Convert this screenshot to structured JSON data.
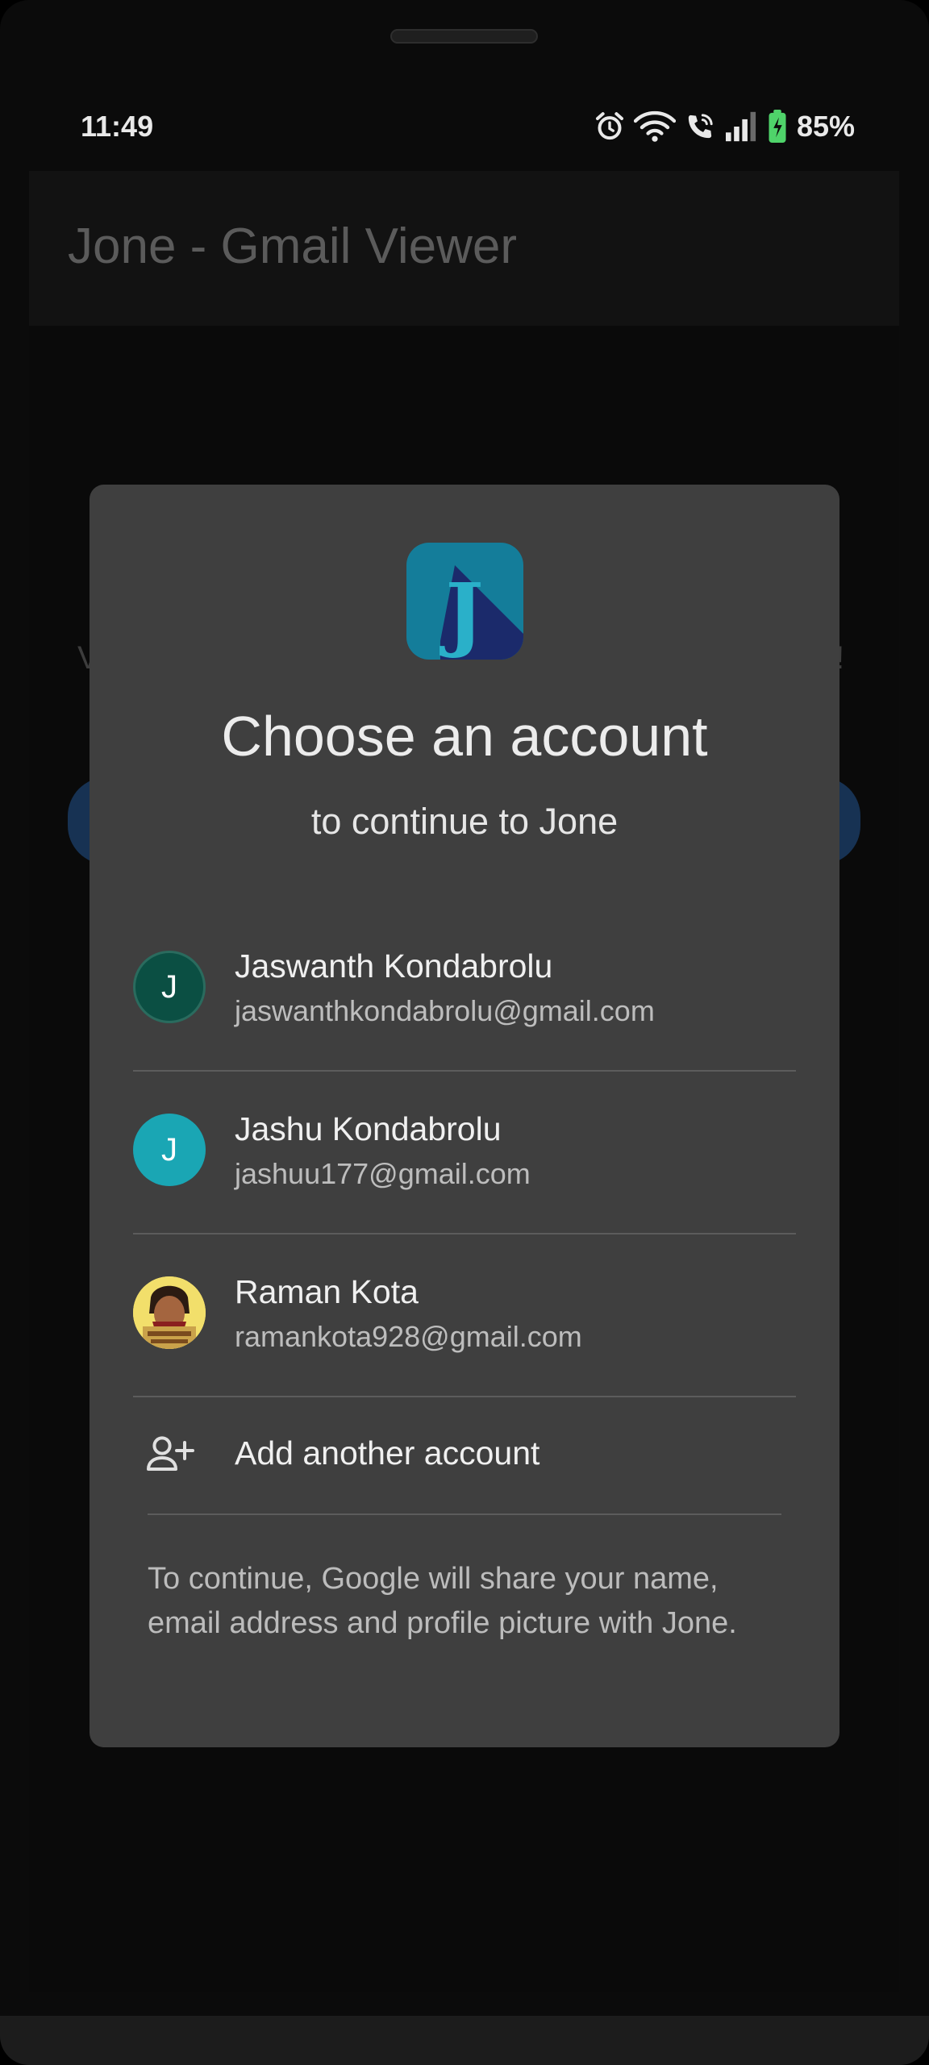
{
  "status_bar": {
    "time": "11:49",
    "battery": "85%",
    "icons": [
      "alarm-icon",
      "wifi-icon",
      "wifi-calling-icon",
      "signal-icon",
      "battery-charging-icon"
    ]
  },
  "app_bar": {
    "title": "Jone - Gmail Viewer"
  },
  "background": {
    "left_fragment": "V",
    "right_fragment": "!"
  },
  "dialog": {
    "app_icon_letter": "J",
    "title": "Choose an account",
    "subtitle": "to continue to Jone",
    "accounts": [
      {
        "initial": "J",
        "name": "Jaswanth Kondabrolu",
        "email": "jaswanthkondabrolu@gmail.com",
        "avatar_color": "#0b4f43"
      },
      {
        "initial": "J",
        "name": "Jashu Kondabrolu",
        "email": "jashuu177@gmail.com",
        "avatar_color": "#1aa6b4"
      },
      {
        "initial": "",
        "name": "Raman Kota",
        "email": "ramankota928@gmail.com",
        "avatar_color": "#f2df6b"
      }
    ],
    "add_account": "Add another account",
    "disclaimer": "To continue, Google will share your name, email address and profile picture with Jone."
  },
  "colors": {
    "dialog_bg": "#3f3f3f",
    "app_icon_bg": "#147d9a",
    "app_icon_shadow": "#1b2a6b",
    "app_icon_letter": "#2ab0c9"
  }
}
